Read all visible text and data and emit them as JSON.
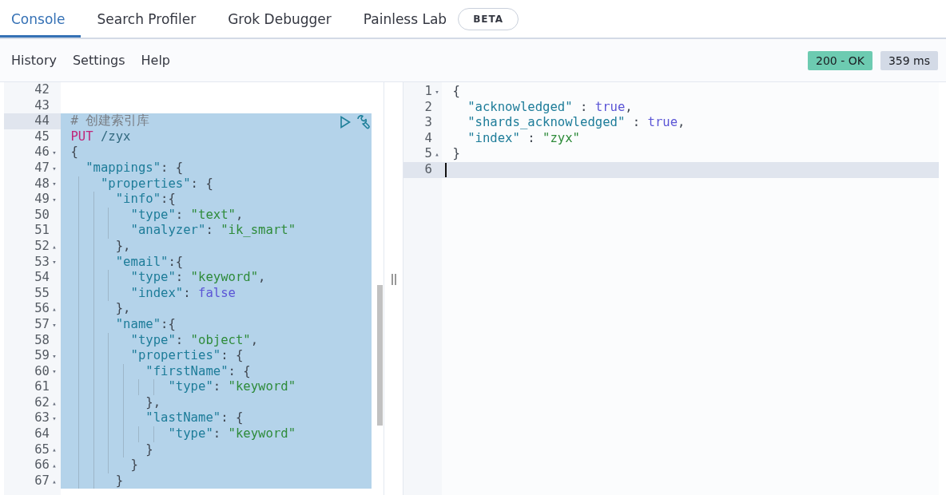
{
  "tabs": [
    {
      "label": "Console",
      "selected": true
    },
    {
      "label": "Search Profiler",
      "selected": false
    },
    {
      "label": "Grok Debugger",
      "selected": false
    },
    {
      "label": "Painless Lab",
      "selected": false,
      "badge": "BETA"
    }
  ],
  "toolbar": {
    "menu": [
      "History",
      "Settings",
      "Help"
    ],
    "status": "200 - OK",
    "time": "359 ms"
  },
  "request_editor": {
    "lines": [
      {
        "number": "42",
        "selected": false,
        "active": false,
        "actions": false
      },
      {
        "number": "43",
        "selected": false,
        "active": false,
        "actions": false
      },
      {
        "number": "44",
        "selected": true,
        "active": true,
        "actions": true,
        "tokens": [
          {
            "kind": "comment",
            "text": "# 创建索引库"
          }
        ]
      },
      {
        "number": "45",
        "selected": true,
        "active": false,
        "actions": false,
        "tokens": [
          {
            "kind": "method",
            "text": "PUT"
          },
          {
            "kind": "path",
            "text": " /zyx"
          }
        ]
      },
      {
        "number": "46",
        "fold": "▾",
        "selected": true,
        "active": false,
        "actions": false,
        "tokens": [
          {
            "kind": "punct",
            "text": "{"
          }
        ]
      },
      {
        "number": "47",
        "fold": "▾",
        "selected": true,
        "active": false,
        "actions": false,
        "tokens": [
          {
            "kind": "key",
            "text": "  \"mappings\""
          },
          {
            "kind": "punct",
            "text": ": {"
          }
        ]
      },
      {
        "number": "48",
        "fold": "▾",
        "selected": true,
        "active": false,
        "actions": false,
        "tokens": [
          {
            "kind": "key",
            "text": "    \"properties\""
          },
          {
            "kind": "punct",
            "text": ": {"
          }
        ]
      },
      {
        "number": "49",
        "fold": "▾",
        "selected": true,
        "active": false,
        "actions": false,
        "tokens": [
          {
            "kind": "key",
            "text": "      \"info\""
          },
          {
            "kind": "punct",
            "text": ":{"
          }
        ]
      },
      {
        "number": "50",
        "selected": true,
        "active": false,
        "actions": false,
        "tokens": [
          {
            "kind": "key",
            "text": "        \"type\""
          },
          {
            "kind": "punct",
            "text": ": "
          },
          {
            "kind": "string",
            "text": "\"text\""
          },
          {
            "kind": "punct",
            "text": ","
          }
        ]
      },
      {
        "number": "51",
        "selected": true,
        "active": false,
        "actions": false,
        "tokens": [
          {
            "kind": "key",
            "text": "        \"analyzer\""
          },
          {
            "kind": "punct",
            "text": ": "
          },
          {
            "kind": "string",
            "text": "\"ik_smart\""
          }
        ]
      },
      {
        "number": "52",
        "fold": "▴",
        "selected": true,
        "active": false,
        "actions": false,
        "tokens": [
          {
            "kind": "punct",
            "text": "      },"
          }
        ]
      },
      {
        "number": "53",
        "fold": "▾",
        "selected": true,
        "active": false,
        "actions": false,
        "tokens": [
          {
            "kind": "key",
            "text": "      \"email\""
          },
          {
            "kind": "punct",
            "text": ":{"
          }
        ]
      },
      {
        "number": "54",
        "selected": true,
        "active": false,
        "actions": false,
        "tokens": [
          {
            "kind": "key",
            "text": "        \"type\""
          },
          {
            "kind": "punct",
            "text": ": "
          },
          {
            "kind": "string",
            "text": "\"keyword\""
          },
          {
            "kind": "punct",
            "text": ","
          }
        ]
      },
      {
        "number": "55",
        "selected": true,
        "active": false,
        "actions": false,
        "tokens": [
          {
            "kind": "key",
            "text": "        \"index\""
          },
          {
            "kind": "punct",
            "text": ": "
          },
          {
            "kind": "bool",
            "text": "false"
          }
        ]
      },
      {
        "number": "56",
        "fold": "▴",
        "selected": true,
        "active": false,
        "actions": false,
        "tokens": [
          {
            "kind": "punct",
            "text": "      },"
          }
        ]
      },
      {
        "number": "57",
        "fold": "▾",
        "selected": true,
        "active": false,
        "actions": false,
        "tokens": [
          {
            "kind": "key",
            "text": "      \"name\""
          },
          {
            "kind": "punct",
            "text": ":{"
          }
        ]
      },
      {
        "number": "58",
        "selected": true,
        "active": false,
        "actions": false,
        "tokens": [
          {
            "kind": "key",
            "text": "        \"type\""
          },
          {
            "kind": "punct",
            "text": ": "
          },
          {
            "kind": "string",
            "text": "\"object\""
          },
          {
            "kind": "punct",
            "text": ","
          }
        ]
      },
      {
        "number": "59",
        "fold": "▾",
        "selected": true,
        "active": false,
        "actions": false,
        "tokens": [
          {
            "kind": "key",
            "text": "        \"properties\""
          },
          {
            "kind": "punct",
            "text": ": {"
          }
        ]
      },
      {
        "number": "60",
        "fold": "▾",
        "selected": true,
        "active": false,
        "actions": false,
        "tokens": [
          {
            "kind": "key",
            "text": "          \"firstName\""
          },
          {
            "kind": "punct",
            "text": ": {"
          }
        ]
      },
      {
        "number": "61",
        "selected": true,
        "active": false,
        "actions": false,
        "tokens": [
          {
            "kind": "key",
            "text": "             \"type\""
          },
          {
            "kind": "punct",
            "text": ": "
          },
          {
            "kind": "string",
            "text": "\"keyword\""
          }
        ]
      },
      {
        "number": "62",
        "fold": "▴",
        "selected": true,
        "active": false,
        "actions": false,
        "tokens": [
          {
            "kind": "punct",
            "text": "          },"
          }
        ]
      },
      {
        "number": "63",
        "fold": "▾",
        "selected": true,
        "active": false,
        "actions": false,
        "tokens": [
          {
            "kind": "key",
            "text": "          \"lastName\""
          },
          {
            "kind": "punct",
            "text": ": {"
          }
        ]
      },
      {
        "number": "64",
        "selected": true,
        "active": false,
        "actions": false,
        "tokens": [
          {
            "kind": "key",
            "text": "             \"type\""
          },
          {
            "kind": "punct",
            "text": ": "
          },
          {
            "kind": "string",
            "text": "\"keyword\""
          }
        ]
      },
      {
        "number": "65",
        "fold": "▴",
        "selected": true,
        "active": false,
        "actions": false,
        "tokens": [
          {
            "kind": "punct",
            "text": "          }"
          }
        ]
      },
      {
        "number": "66",
        "fold": "▴",
        "selected": true,
        "active": false,
        "actions": false,
        "tokens": [
          {
            "kind": "punct",
            "text": "        }"
          }
        ]
      },
      {
        "number": "67",
        "fold": "▴",
        "selected": true,
        "active": false,
        "actions": false,
        "tokens": [
          {
            "kind": "punct",
            "text": "      }"
          }
        ]
      }
    ]
  },
  "response_editor": {
    "lines": [
      {
        "number": "1",
        "fold": "▾",
        "active": false,
        "cursor": false,
        "tokens": [
          {
            "kind": "punct",
            "text": "{"
          }
        ]
      },
      {
        "number": "2",
        "active": false,
        "cursor": false,
        "tokens": [
          {
            "kind": "key",
            "text": "  \"acknowledged\""
          },
          {
            "kind": "punct",
            "text": " : "
          },
          {
            "kind": "bool",
            "text": "true"
          },
          {
            "kind": "punct",
            "text": ","
          }
        ]
      },
      {
        "number": "3",
        "active": false,
        "cursor": false,
        "tokens": [
          {
            "kind": "key",
            "text": "  \"shards_acknowledged\""
          },
          {
            "kind": "punct",
            "text": " : "
          },
          {
            "kind": "bool",
            "text": "true"
          },
          {
            "kind": "punct",
            "text": ","
          }
        ]
      },
      {
        "number": "4",
        "active": false,
        "cursor": false,
        "tokens": [
          {
            "kind": "key",
            "text": "  \"index\""
          },
          {
            "kind": "punct",
            "text": " : "
          },
          {
            "kind": "string",
            "text": "\"zyx\""
          }
        ]
      },
      {
        "number": "5",
        "fold": "▴",
        "active": false,
        "cursor": false,
        "tokens": [
          {
            "kind": "punct",
            "text": "}"
          }
        ]
      },
      {
        "number": "6",
        "active": true,
        "cursor": true
      }
    ]
  }
}
